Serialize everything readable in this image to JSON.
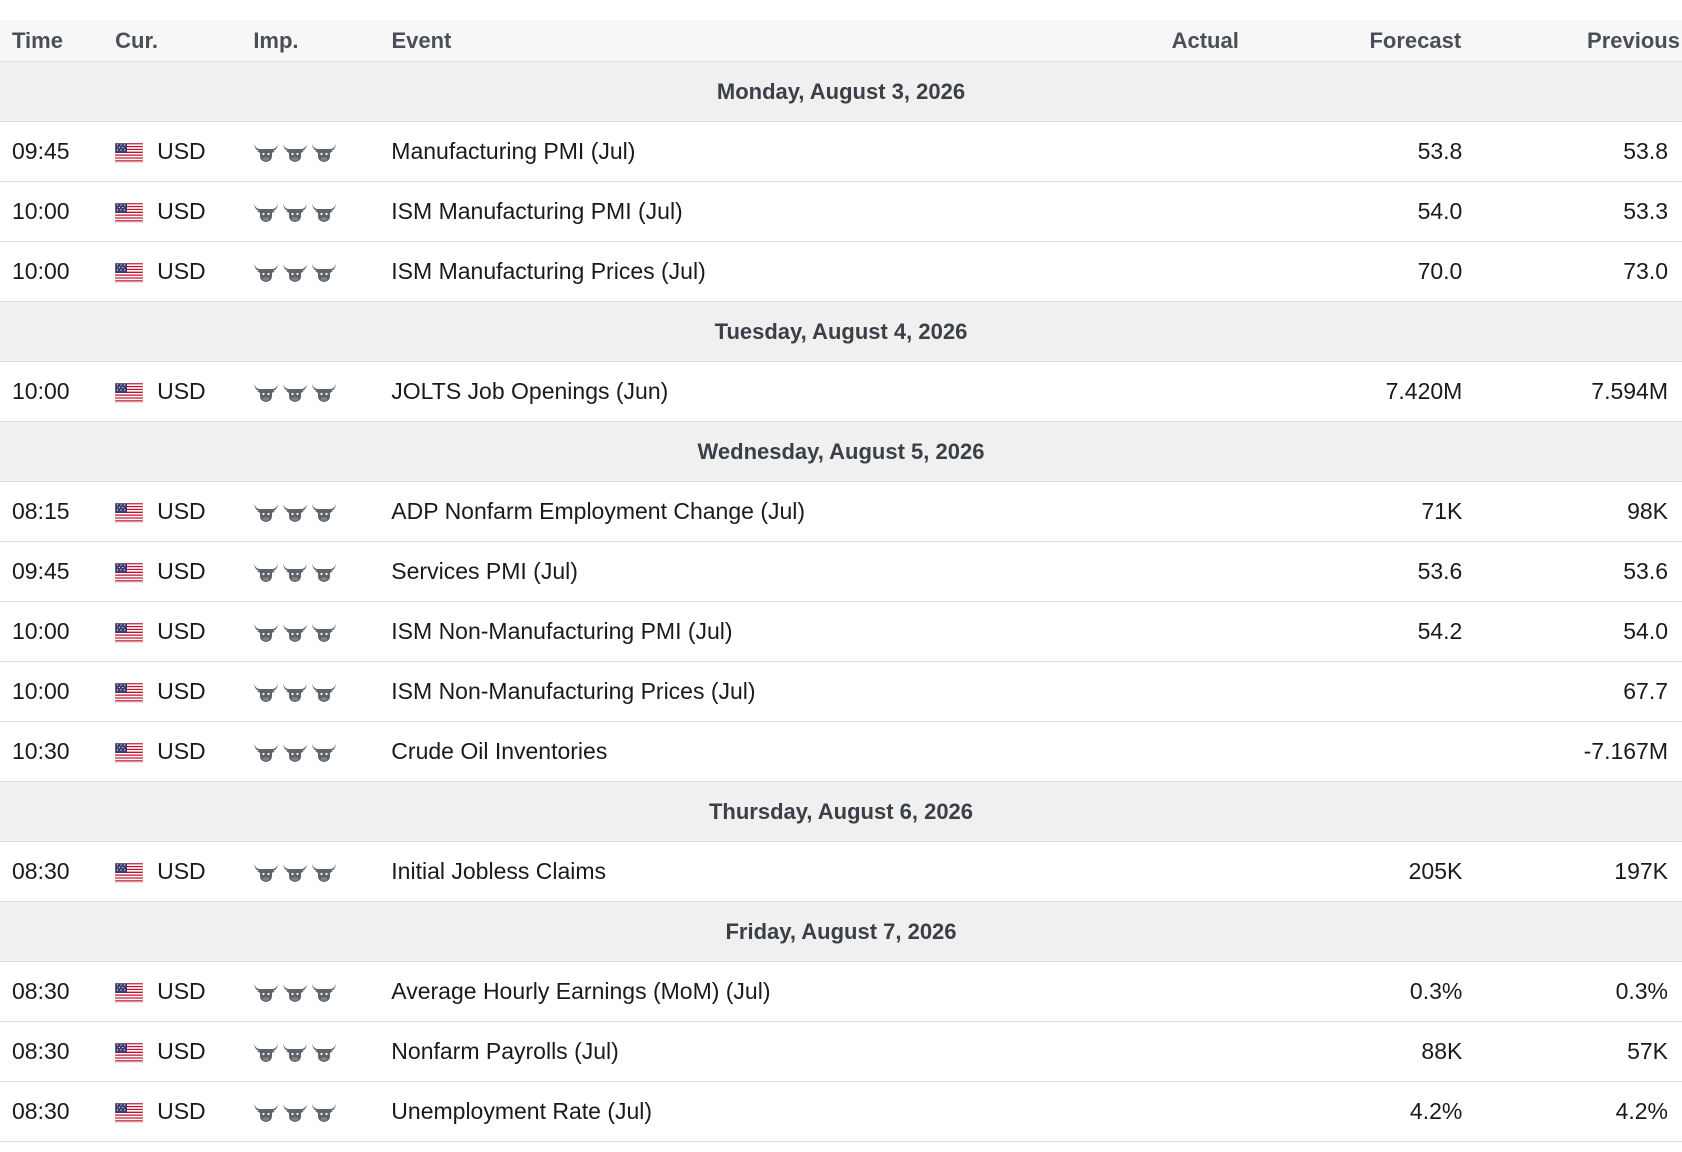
{
  "headers": {
    "time": "Time",
    "cur": "Cur.",
    "imp": "Imp.",
    "event": "Event",
    "actual": "Actual",
    "forecast": "Forecast",
    "previous": "Previous"
  },
  "importance_icon": "bull-icon",
  "flag_icon": "us-flag-icon",
  "rows": [
    {
      "type": "date",
      "label": "Monday, August 3, 2026"
    },
    {
      "type": "event",
      "time": "09:45",
      "currency": "USD",
      "importance": 3,
      "event": "Manufacturing PMI (Jul)",
      "actual": "",
      "forecast": "53.8",
      "previous": "53.8"
    },
    {
      "type": "event",
      "time": "10:00",
      "currency": "USD",
      "importance": 3,
      "event": "ISM Manufacturing PMI (Jul)",
      "actual": "",
      "forecast": "54.0",
      "previous": "53.3"
    },
    {
      "type": "event",
      "time": "10:00",
      "currency": "USD",
      "importance": 3,
      "event": "ISM Manufacturing Prices (Jul)",
      "actual": "",
      "forecast": "70.0",
      "previous": "73.0"
    },
    {
      "type": "date",
      "label": "Tuesday, August 4, 2026"
    },
    {
      "type": "event",
      "time": "10:00",
      "currency": "USD",
      "importance": 3,
      "event": "JOLTS Job Openings (Jun)",
      "actual": "",
      "forecast": "7.420M",
      "previous": "7.594M"
    },
    {
      "type": "date",
      "label": "Wednesday, August 5, 2026"
    },
    {
      "type": "event",
      "time": "08:15",
      "currency": "USD",
      "importance": 3,
      "event": "ADP Nonfarm Employment Change (Jul)",
      "actual": "",
      "forecast": "71K",
      "previous": "98K"
    },
    {
      "type": "event",
      "time": "09:45",
      "currency": "USD",
      "importance": 3,
      "event": "Services PMI (Jul)",
      "actual": "",
      "forecast": "53.6",
      "previous": "53.6"
    },
    {
      "type": "event",
      "time": "10:00",
      "currency": "USD",
      "importance": 3,
      "event": "ISM Non-Manufacturing PMI (Jul)",
      "actual": "",
      "forecast": "54.2",
      "previous": "54.0"
    },
    {
      "type": "event",
      "time": "10:00",
      "currency": "USD",
      "importance": 3,
      "event": "ISM Non-Manufacturing Prices (Jul)",
      "actual": "",
      "forecast": "",
      "previous": "67.7"
    },
    {
      "type": "event",
      "time": "10:30",
      "currency": "USD",
      "importance": 3,
      "event": "Crude Oil Inventories",
      "actual": "",
      "forecast": "",
      "previous": "-7.167M"
    },
    {
      "type": "date",
      "label": "Thursday, August 6, 2026"
    },
    {
      "type": "event",
      "time": "08:30",
      "currency": "USD",
      "importance": 3,
      "event": "Initial Jobless Claims",
      "actual": "",
      "forecast": "205K",
      "previous": "197K"
    },
    {
      "type": "date",
      "label": "Friday, August 7, 2026"
    },
    {
      "type": "event",
      "time": "08:30",
      "currency": "USD",
      "importance": 3,
      "event": "Average Hourly Earnings (MoM) (Jul)",
      "actual": "",
      "forecast": "0.3%",
      "previous": "0.3%"
    },
    {
      "type": "event",
      "time": "08:30",
      "currency": "USD",
      "importance": 3,
      "event": "Nonfarm Payrolls (Jul)",
      "actual": "",
      "forecast": "88K",
      "previous": "57K"
    },
    {
      "type": "event",
      "time": "08:30",
      "currency": "USD",
      "importance": 3,
      "event": "Unemployment Rate (Jul)",
      "actual": "",
      "forecast": "4.2%",
      "previous": "4.2%"
    }
  ]
}
